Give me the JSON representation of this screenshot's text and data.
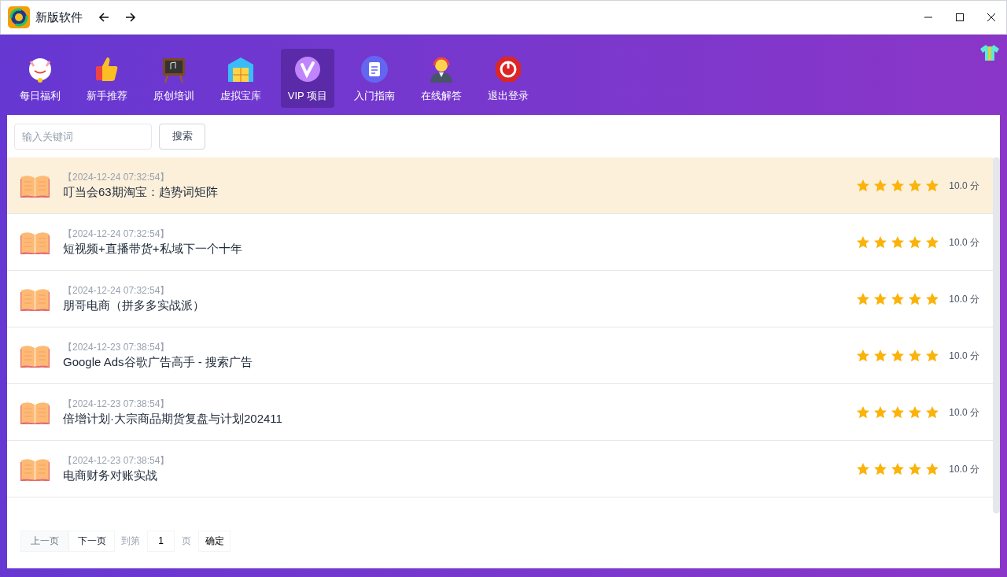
{
  "window": {
    "title": "新版软件"
  },
  "nav": [
    {
      "label": "每日福利",
      "kind": "cat",
      "selected": false
    },
    {
      "label": "新手推荐",
      "kind": "thumb",
      "selected": false
    },
    {
      "label": "原创培训",
      "kind": "board",
      "selected": false
    },
    {
      "label": "虚拟宝库",
      "kind": "warehouse",
      "selected": false
    },
    {
      "label": "VIP 项目",
      "kind": "vip",
      "selected": true
    },
    {
      "label": "入门指南",
      "kind": "doc",
      "selected": false
    },
    {
      "label": "在线解答",
      "kind": "support",
      "selected": false
    },
    {
      "label": "退出登录",
      "kind": "power",
      "selected": false
    }
  ],
  "search": {
    "placeholder": "输入关键词",
    "button": "搜索"
  },
  "items": [
    {
      "time": "【2024-12-24 07:32:54】",
      "title": "叮当会63期淘宝：趋势词矩阵",
      "stars": 5,
      "score": "10.0 分",
      "selected": true
    },
    {
      "time": "【2024-12-24 07:32:54】",
      "title": "短视频+直播带货+私域下一个十年",
      "stars": 5,
      "score": "10.0 分",
      "selected": false
    },
    {
      "time": "【2024-12-24 07:32:54】",
      "title": "朋哥电商（拼多多实战派）",
      "stars": 5,
      "score": "10.0 分",
      "selected": false
    },
    {
      "time": "【2024-12-23 07:38:54】",
      "title": "Google Ads谷歌广告高手 - 搜索广告",
      "stars": 5,
      "score": "10.0 分",
      "selected": false
    },
    {
      "time": "【2024-12-23 07:38:54】",
      "title": "倍增计划·大宗商品期货复盘与计划202411",
      "stars": 5,
      "score": "10.0 分",
      "selected": false
    },
    {
      "time": "【2024-12-23 07:38:54】",
      "title": "电商财务对账实战",
      "stars": 5,
      "score": "10.0 分",
      "selected": false
    }
  ],
  "pager": {
    "prev": {
      "label": "上一页",
      "disabled": true
    },
    "next": {
      "label": "下一页",
      "disabled": false
    },
    "goto_label": "到第",
    "page": "1",
    "page_unit": "页",
    "confirm": "确定"
  }
}
